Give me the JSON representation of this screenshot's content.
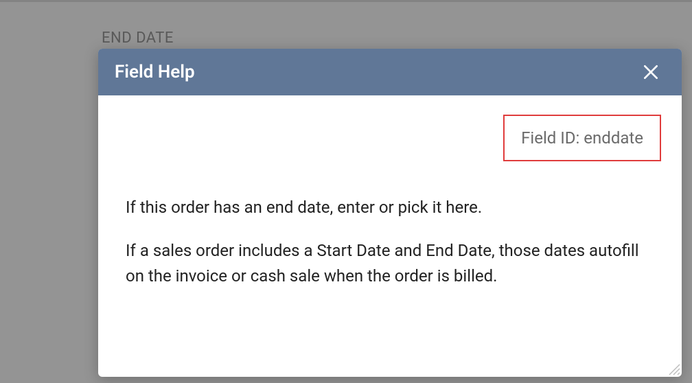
{
  "field": {
    "label": "END DATE"
  },
  "modal": {
    "title": "Field Help",
    "field_id_label": "Field ID: enddate",
    "paragraph1": "If this order has an end date, enter or pick it here.",
    "paragraph2": "If a sales order includes a Start Date and End Date, those dates autofill on the invoice or cash sale when the order is billed."
  }
}
